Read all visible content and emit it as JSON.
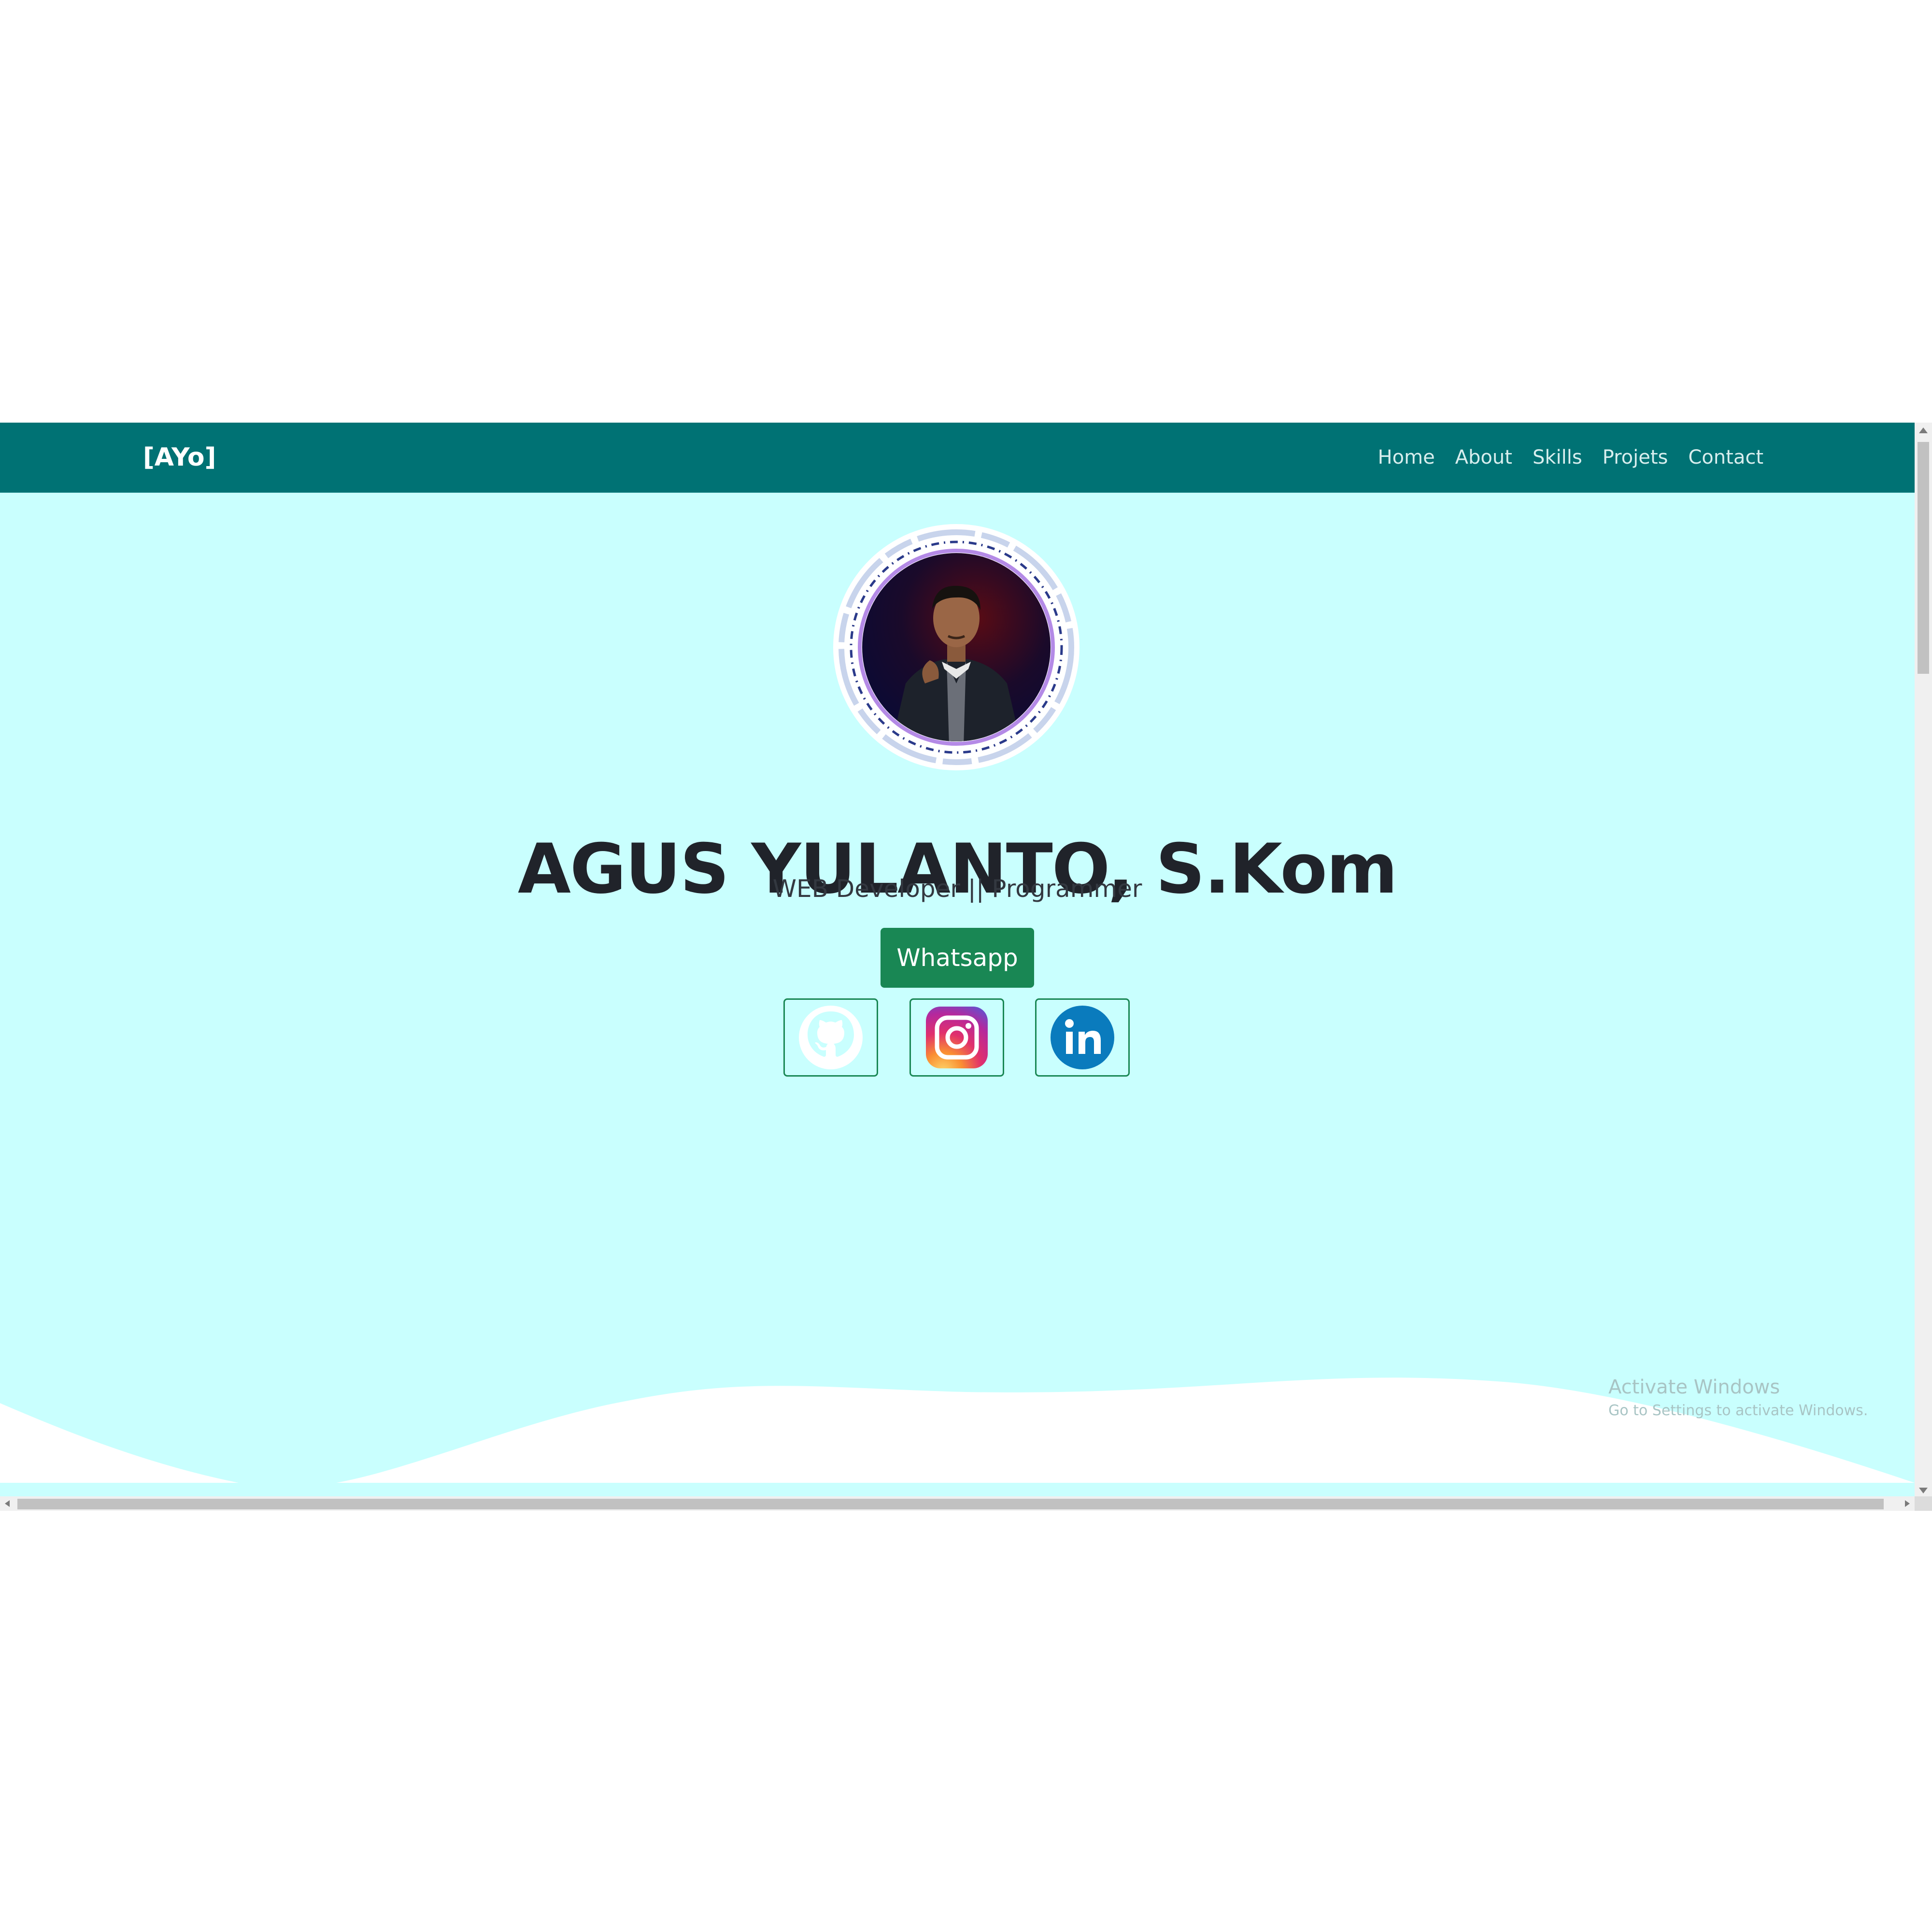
{
  "navbar": {
    "brand": "[AYo]",
    "links": [
      "Home",
      "About",
      "Skills",
      "Projets",
      "Contact"
    ]
  },
  "hero": {
    "name": "AGUS YULANTO, S.Kom",
    "role": "WEB Developer || Programmer",
    "cta_label": "Whatsapp",
    "avatar_alt": "profile-photo"
  },
  "social": [
    {
      "name": "github",
      "icon": "github-icon"
    },
    {
      "name": "instagram",
      "icon": "instagram-icon"
    },
    {
      "name": "linkedin",
      "icon": "linkedin-icon"
    }
  ],
  "watermark": {
    "title": "Activate Windows",
    "subtitle": "Go to Settings to activate Windows."
  },
  "colors": {
    "navbar": "#007274",
    "hero_bg": "#c9fffe",
    "button": "#198754",
    "text_dark": "#20232a"
  }
}
